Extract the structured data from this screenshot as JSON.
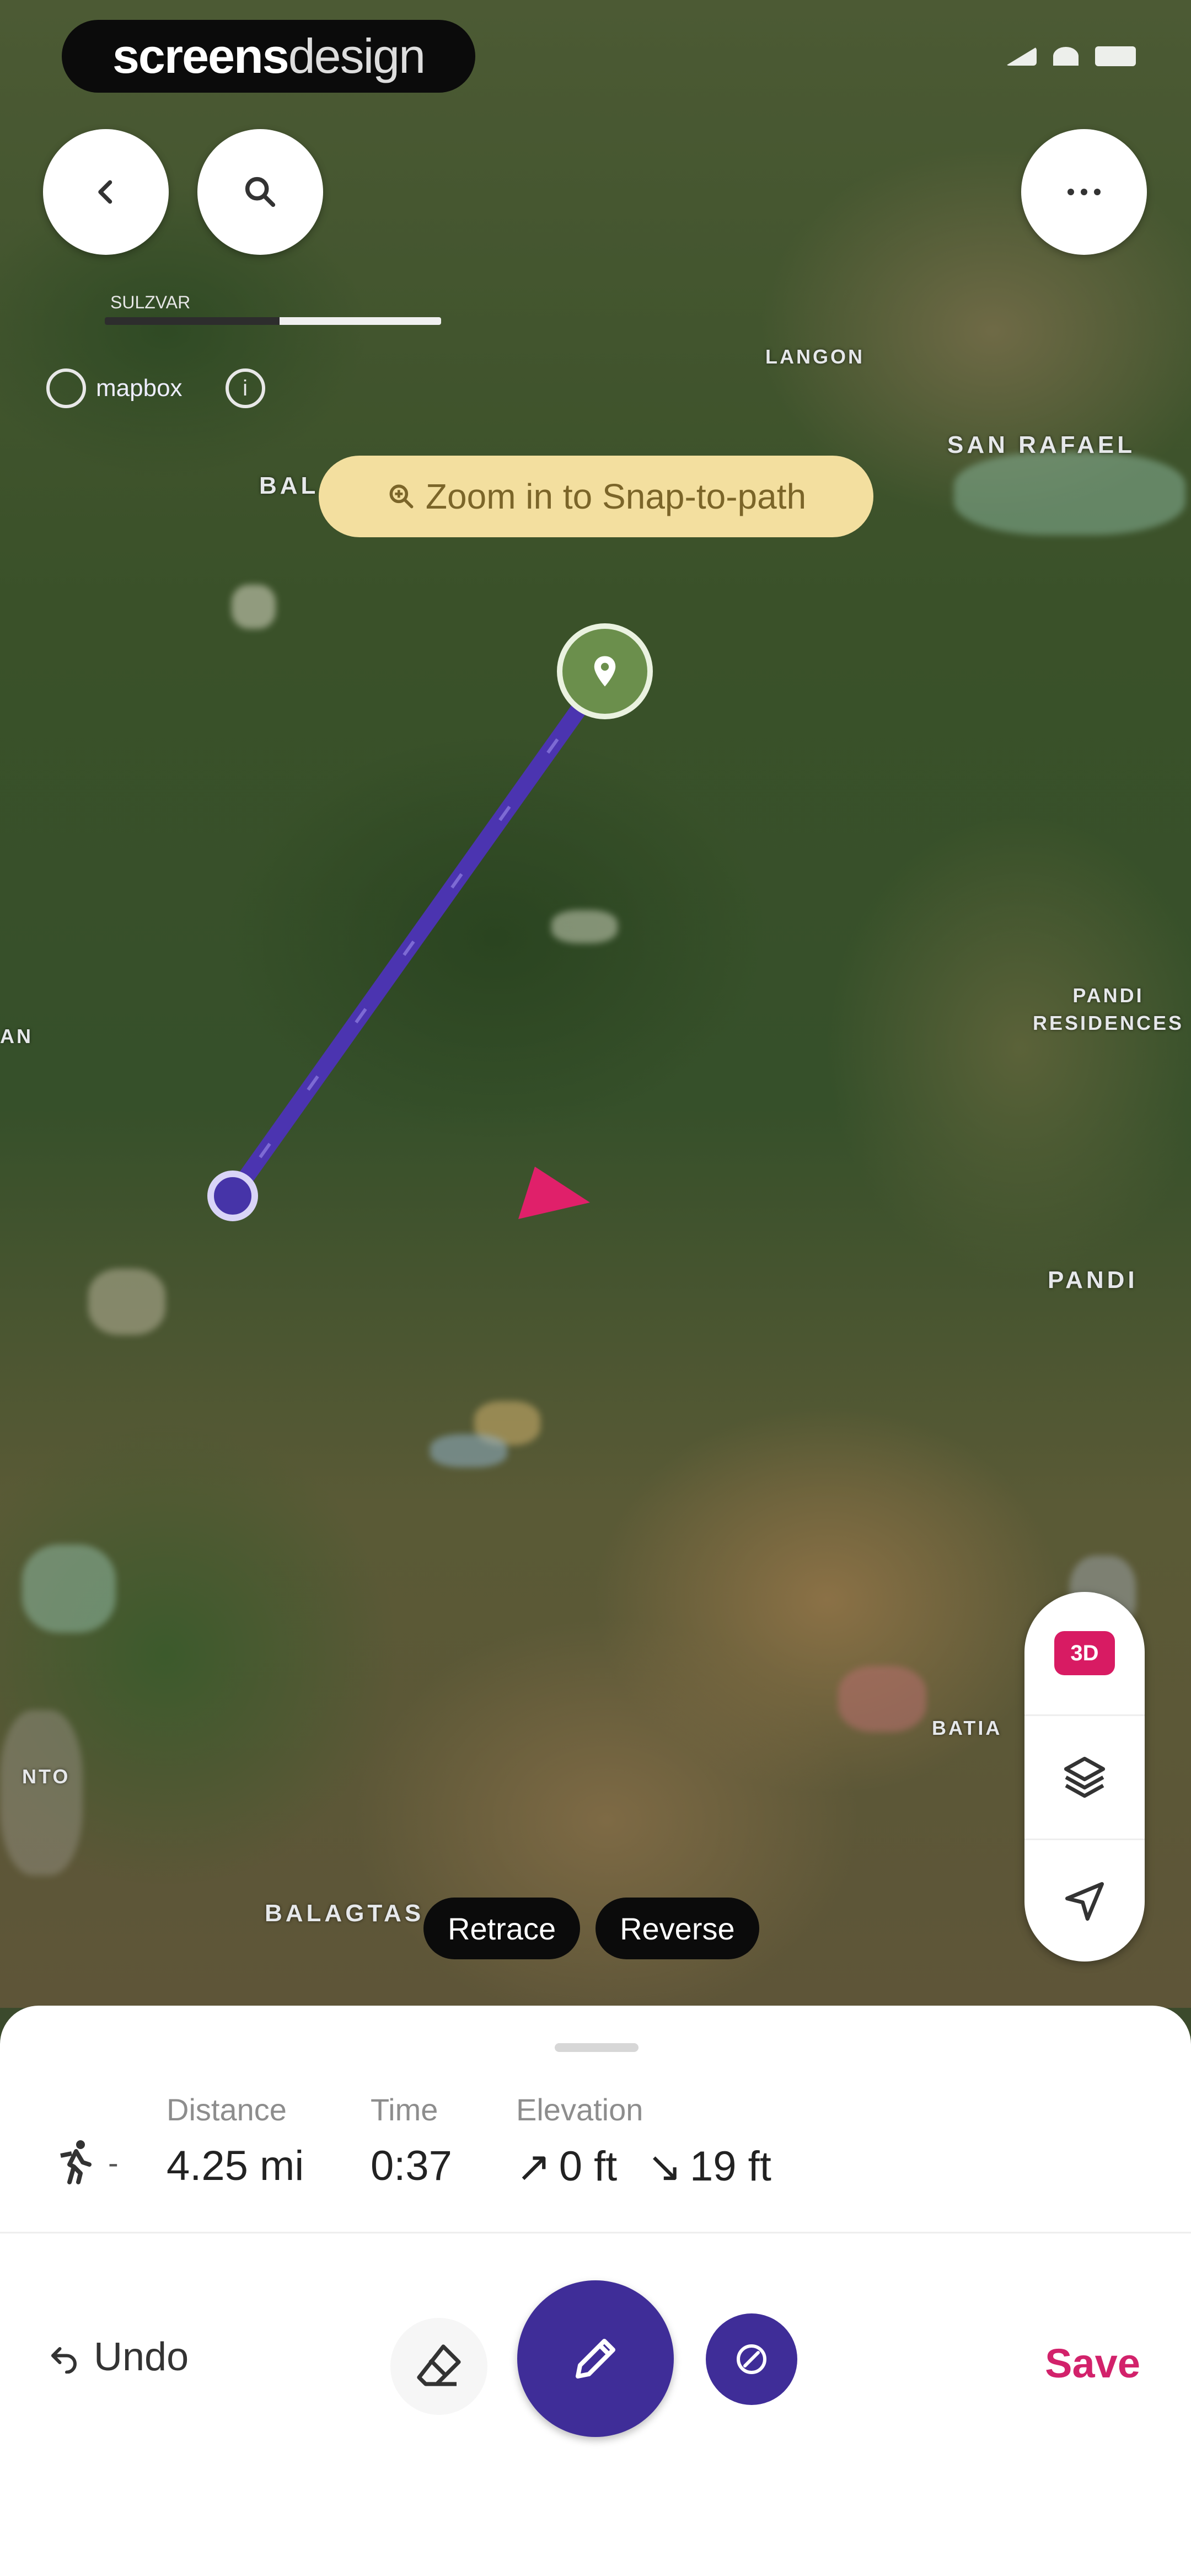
{
  "brand": {
    "part1": "screens",
    "part2": "design"
  },
  "map": {
    "scale_label": "SULZVAR",
    "attribution": "mapbox",
    "zoom_tip": "Zoom in to Snap-to-path",
    "labels": [
      "SAN RAFAEL",
      "LANGON",
      "PANDI RESIDENCES",
      "PANDI",
      "BALAGTAS",
      "BAL",
      "BATIA",
      "AN",
      "NTO"
    ],
    "route_color": "#4b34b0"
  },
  "controls": {
    "three_d_label": "3D"
  },
  "route_actions": {
    "retrace": "Retrace",
    "reverse": "Reverse"
  },
  "stats": {
    "distance_label": "Distance",
    "distance_value": "4.25 mi",
    "time_label": "Time",
    "time_value": "0:37",
    "elevation_label": "Elevation",
    "elev_up": "0 ft",
    "elev_down": "19 ft",
    "activity_suffix": "-"
  },
  "toolbar": {
    "undo_label": "Undo",
    "save_label": "Save"
  },
  "colors": {
    "accent": "#3f2d98",
    "save": "#d2226b",
    "tip_bg": "#f3df9f"
  }
}
